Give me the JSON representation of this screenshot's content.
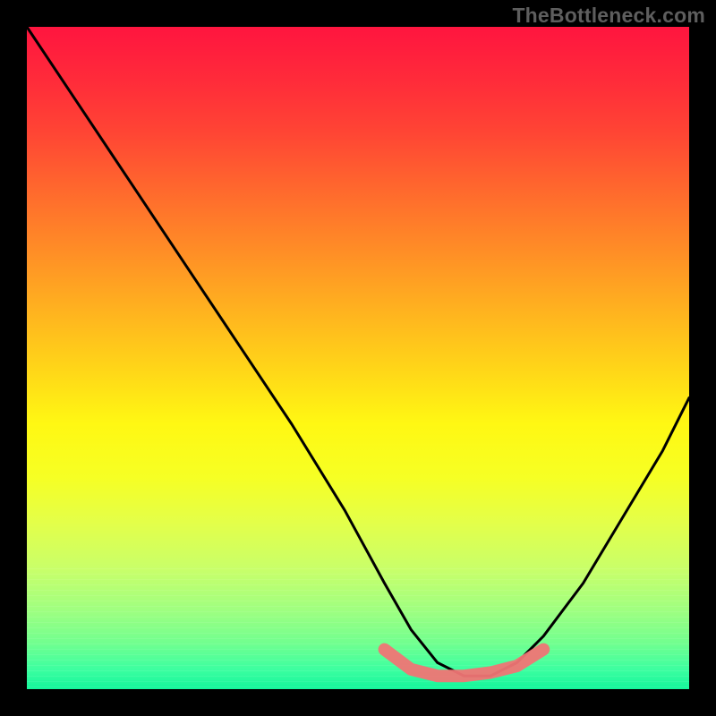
{
  "watermark": "TheBottleneck.com",
  "chart_data": {
    "type": "line",
    "title": "",
    "xlabel": "",
    "ylabel": "",
    "xlim": [
      0,
      100
    ],
    "ylim": [
      0,
      100
    ],
    "grid": false,
    "series": [
      {
        "name": "black-curve",
        "color": "#000000",
        "x": [
          0,
          8,
          16,
          24,
          32,
          40,
          48,
          54,
          58,
          62,
          66,
          70,
          74,
          78,
          84,
          90,
          96,
          100
        ],
        "values": [
          100,
          88,
          76,
          64,
          52,
          40,
          27,
          16,
          9,
          4,
          2,
          2,
          4,
          8,
          16,
          26,
          36,
          44
        ]
      },
      {
        "name": "pink-highlight",
        "color": "#f07575",
        "x": [
          54,
          58,
          62,
          66,
          70,
          74,
          78
        ],
        "values": [
          6,
          3,
          2,
          2,
          2.5,
          3.5,
          6
        ]
      }
    ],
    "annotations": []
  },
  "colors": {
    "background": "#000000",
    "gradient_top": "#ff153f",
    "gradient_bottom": "#14f59b",
    "curve": "#000000",
    "highlight": "#f07575",
    "watermark": "#5e5e5e"
  }
}
